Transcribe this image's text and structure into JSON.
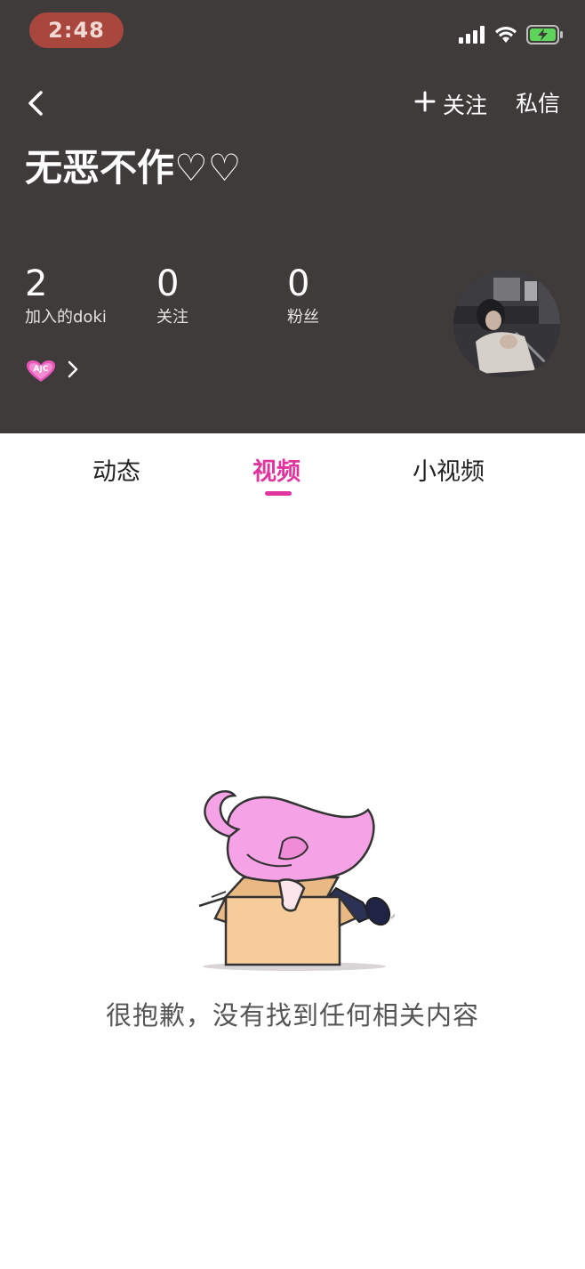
{
  "status_bar": {
    "time": "2:48",
    "icons": [
      "signal-icon",
      "wifi-icon",
      "battery-charging-icon"
    ],
    "colors": {
      "time_pill": "#a9473f",
      "battery": "#5ed45a"
    }
  },
  "header": {
    "back_icon": "chevron-left-icon",
    "follow_icon": "plus-icon",
    "follow_label": "关注",
    "message_label": "私信",
    "title": "无恶不作♡♡",
    "background": "#3f3b3b",
    "stats": [
      {
        "value": "2",
        "label": "加入的doki"
      },
      {
        "value": "0",
        "label": "关注"
      },
      {
        "value": "0",
        "label": "粉丝"
      }
    ],
    "badge_icon": "ajc-heart-badge-icon",
    "badge_text": "AJC",
    "more_icon": "chevron-right-icon"
  },
  "tabs": {
    "items": [
      {
        "label": "动态",
        "active": false
      },
      {
        "label": "视频",
        "active": true
      },
      {
        "label": "小视频",
        "active": false
      }
    ],
    "accent": "#e0359e"
  },
  "empty_state": {
    "illustration": "character-in-box-illustration",
    "message": "很抱歉，没有找到任何相关内容"
  }
}
